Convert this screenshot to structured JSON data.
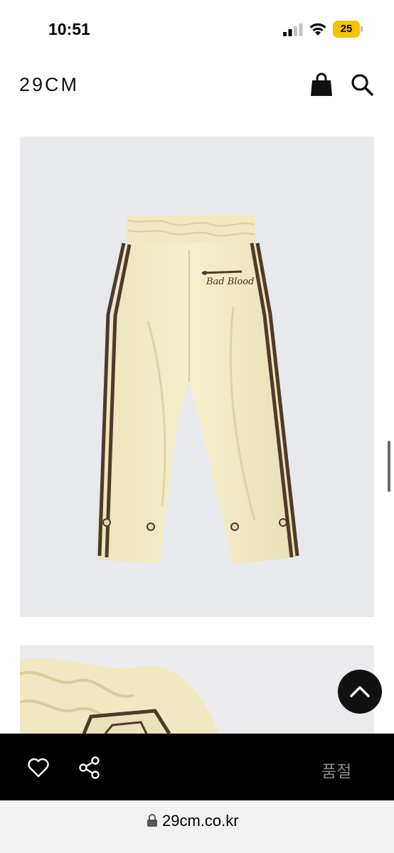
{
  "status_bar": {
    "time": "10:51",
    "battery_level": "25",
    "icons": [
      "cellular-signal-icon",
      "wifi-icon",
      "battery-icon"
    ]
  },
  "header": {
    "logo": "29CM",
    "icons": [
      "shopping-bag-icon",
      "search-icon"
    ]
  },
  "product_images": {
    "main_image_print": "Bad Blood",
    "colors": {
      "background": "#e8e9ed",
      "pants": "#f1ebc6",
      "stripe": "#4f3a2b"
    }
  },
  "scroll_top_button": {
    "icon": "chevron-up-icon"
  },
  "action_bar": {
    "like_icon": "heart-icon",
    "share_icon": "share-icon",
    "status_label": "품절"
  },
  "browser": {
    "url": "29cm.co.kr",
    "lock_icon": "lock-icon"
  }
}
